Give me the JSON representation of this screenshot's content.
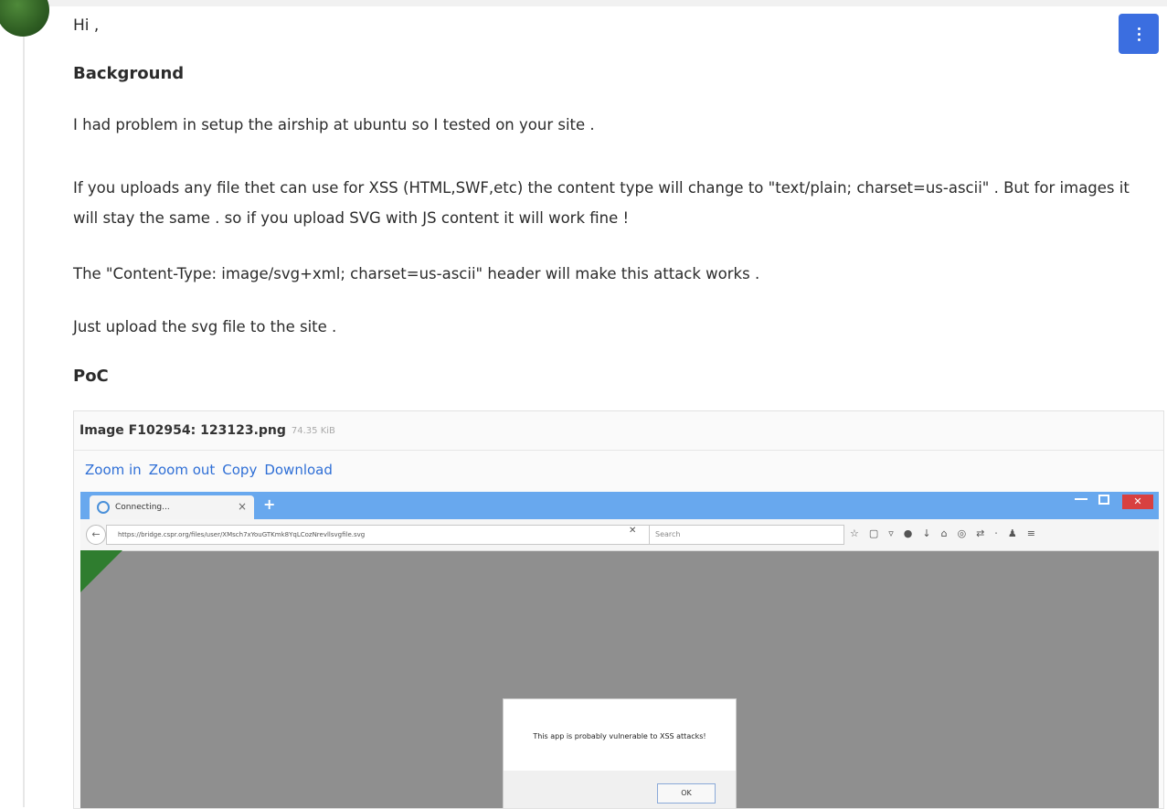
{
  "comment": {
    "greeting": "Hi ,",
    "background_heading": "Background",
    "para1": "I had problem in setup the airship at ubuntu so I tested on your site .",
    "para2": "If you uploads any file thet can use for XSS (HTML,SWF,etc) the content type will change to \"text/plain; charset=us-ascii\" . But for images it will stay the same . so if you upload SVG with JS content it will work fine !",
    "para3": "The \"Content-Type: image/svg+xml; charset=us-ascii\" header will make this attack works .",
    "para4": "Just upload the svg file to the site .",
    "poc_heading": "PoC"
  },
  "attachment": {
    "title": "Image F102954: 123123.png",
    "size": "74.35 KiB",
    "actions": [
      "Zoom in",
      "Zoom out",
      "Copy",
      "Download"
    ]
  },
  "screenshot": {
    "tab_title": "Connecting...",
    "tab_close": "×",
    "new_tab": "+",
    "close_btn": "✕",
    "url": "https://bridge.cspr.org/files/user/XMsch7xYouGTKmk8YqLCozNrevllsvgfile.svg",
    "search_placeholder": "Search",
    "dialog_message": "This app is probably vulnerable to XSS attacks!",
    "dialog_ok": "OK"
  },
  "colors": {
    "menu_button": "#3b6ee0",
    "link": "#2f6fd6",
    "tabbar": "#68a8ee"
  }
}
